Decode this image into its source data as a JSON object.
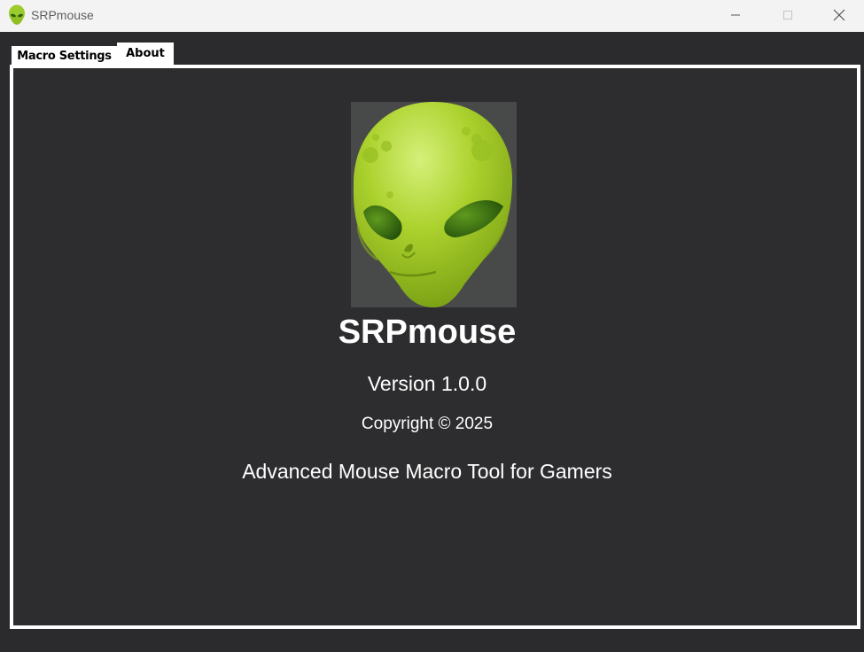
{
  "window": {
    "title": "SRPmouse"
  },
  "tabs": [
    {
      "label": "Macro Settings",
      "selected": false
    },
    {
      "label": "About",
      "selected": true
    }
  ],
  "about": {
    "app_name": "SRPmouse",
    "version": "Version 1.0.0",
    "copyright": "Copyright © 2025",
    "tagline": "Advanced Mouse Macro Tool for Gamers",
    "logo_icon": "alien-head-icon"
  },
  "colors": {
    "background": "#2b2b2d",
    "titlebar": "#f3f3f3",
    "panel_border": "#ffffff",
    "text": "#ffffff",
    "alien_green": "#a8d02c",
    "logo_bg": "#484a4a"
  }
}
